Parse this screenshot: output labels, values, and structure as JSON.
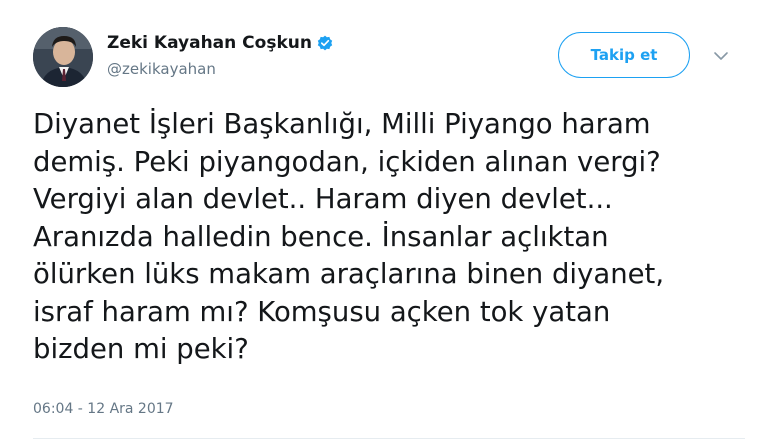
{
  "user": {
    "display_name": "Zeki Kayahan Coşkun",
    "handle": "@zekikayahan",
    "verified": true
  },
  "actions": {
    "follow_label": "Takip et",
    "menu_icon": "chevron-down-icon"
  },
  "tweet": {
    "text": "Diyanet İşleri Başkanlığı, Milli Piyango haram\ndemiş. Peki piyangodan, içkiden alınan vergi?\nVergiyi alan devlet.. Haram diyen devlet...\nAranızda halledin bence. İnsanlar açlıktan\nölürken lüks makam araçlarına binen diyanet,\nisraf haram mı? Komşusu açken tok yatan\nbizden mi peki?",
    "timestamp": "06:04 - 12 Ara 2017"
  },
  "colors": {
    "accent": "#1da1f2",
    "text": "#14171a",
    "secondary": "#657786",
    "divider": "#e6ecf0"
  }
}
